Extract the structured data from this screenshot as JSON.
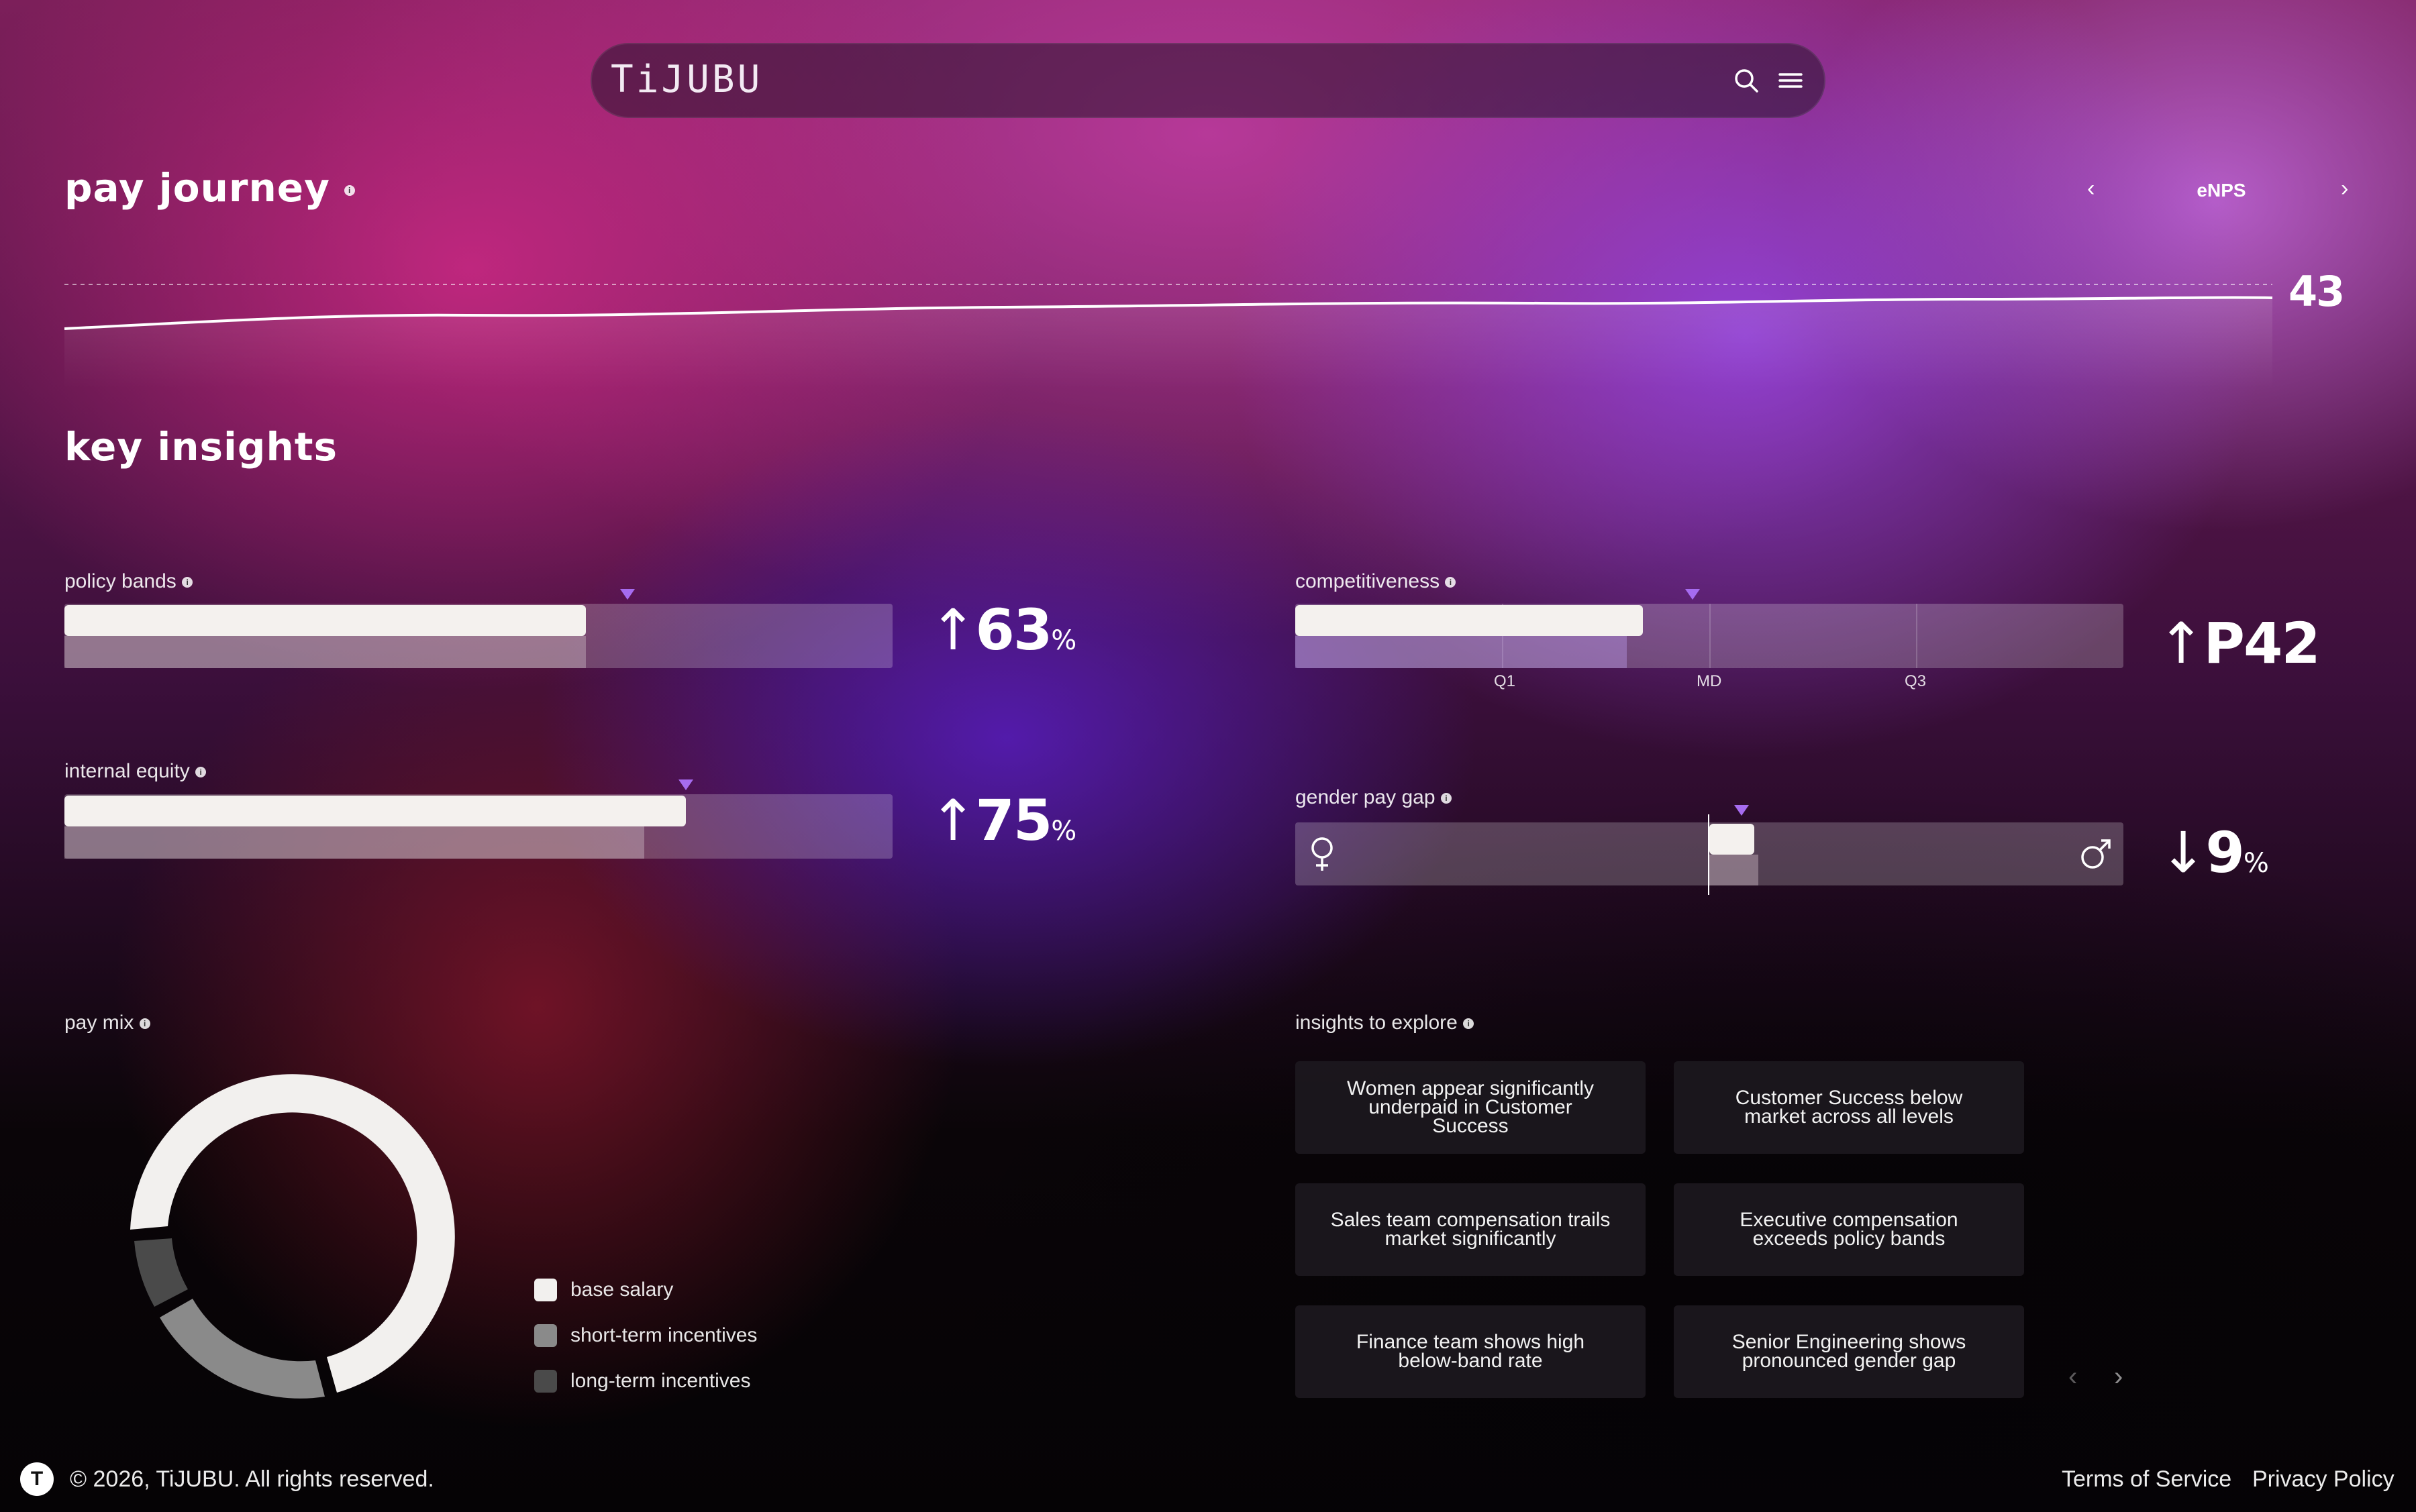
{
  "brand": "TiJUBU",
  "header": {
    "search_icon": "search-icon",
    "menu_icon": "menu-icon"
  },
  "pay_journey": {
    "title": "pay journey",
    "info": "i",
    "metric_nav": {
      "prev": "‹",
      "label": "eNPS",
      "next": "›"
    },
    "value": "43"
  },
  "key_insights": {
    "title": "key insights"
  },
  "policy_bands": {
    "label": "policy bands",
    "info": "i",
    "arrow": "↑",
    "value": "63",
    "unit": "%",
    "fill_fraction": 0.63,
    "secondary_fraction": 0.63,
    "marker_fraction": 0.68
  },
  "competitiveness": {
    "label": "competitiveness",
    "info": "i",
    "arrow": "↑",
    "value": "P42",
    "quartiles": [
      "Q1",
      "MD",
      "Q3"
    ],
    "fill_fraction": 0.42,
    "secondary_fraction": 0.4,
    "marker_fraction": 0.48
  },
  "internal_equity": {
    "label": "internal equity",
    "info": "i",
    "arrow": "↑",
    "value": "75",
    "unit": "%",
    "fill_fraction": 0.75,
    "secondary_fraction": 0.7,
    "marker_fraction": 0.75
  },
  "gender_pay_gap": {
    "label": "gender pay gap",
    "info": "i",
    "arrow": "↓",
    "value": "9",
    "unit": "%",
    "female_icon": "female-icon",
    "male_icon": "male-icon",
    "gap_fraction": 0.09
  },
  "pay_mix": {
    "label": "pay mix",
    "info": "i",
    "legend": [
      {
        "label": "base salary",
        "color": "#f2f0ee"
      },
      {
        "label": "short-term incentives",
        "color": "#8a8a8a"
      },
      {
        "label": "long-term incentives",
        "color": "#4a4a4a"
      }
    ]
  },
  "insights_to_explore": {
    "label": "insights to explore",
    "info": "i",
    "cards": [
      "Women appear significantly underpaid in Customer Success",
      "Customer Success below market across all levels",
      "Sales team compensation trails market significantly",
      "Executive compensation exceeds policy bands",
      "Finance team shows high below-band rate",
      "Senior Engineering shows pronounced gender gap"
    ],
    "prev": "‹",
    "next": "›"
  },
  "footer": {
    "logo": "T",
    "copyright": "© 2026, TiJUBU. All rights reserved.",
    "terms": "Terms of Service",
    "privacy": "Privacy Policy"
  },
  "colors": {
    "accent_marker": "#a66cf0",
    "bar_fill": "#f4f1ee",
    "card_bg": "#1c181e"
  }
}
